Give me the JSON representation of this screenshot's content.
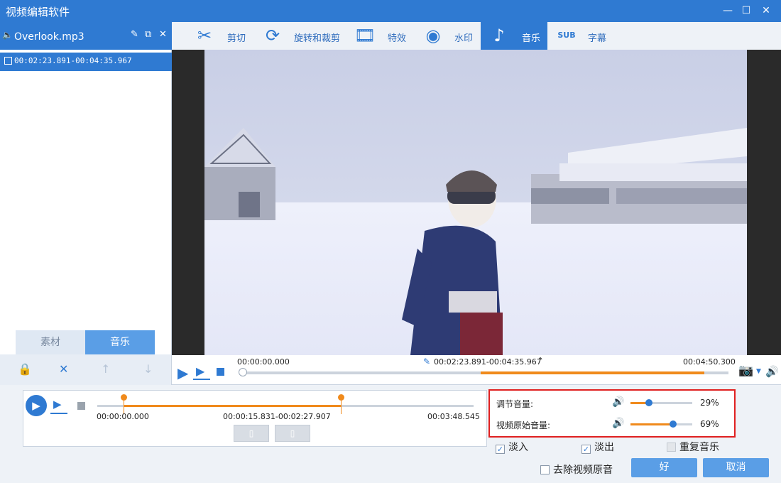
{
  "window": {
    "title": "视频编辑软件",
    "minimize": "—",
    "maximize": "☐",
    "close": "✕"
  },
  "left_panel": {
    "file_name": "Overlook.mp3",
    "segment": "00:02:23.891-00:04:35.967",
    "tabs": [
      {
        "label": "素材"
      },
      {
        "label": "音乐"
      }
    ]
  },
  "toolbar": {
    "items": [
      {
        "label": "剪切",
        "icon": "scissors-icon"
      },
      {
        "label": "旋转和裁剪",
        "icon": "rotate-crop-icon"
      },
      {
        "label": "特效",
        "icon": "effects-icon"
      },
      {
        "label": "水印",
        "icon": "watermark-icon"
      },
      {
        "label": "音乐",
        "icon": "music-note-icon"
      },
      {
        "label": "字幕",
        "icon": "subtitle-icon"
      }
    ]
  },
  "playback": {
    "start_time": "00:00:00.000",
    "segment_range": "00:02:23.891-00:04:35.967",
    "end_time": "00:04:50.300"
  },
  "trim": {
    "start": "00:00:00.000",
    "range": "00:00:15.831-00:02:27.907",
    "end": "00:03:48.545"
  },
  "volume": {
    "adjust_label": "调节音量:",
    "adjust_value": "29%",
    "original_label": "视频原始音量:",
    "original_value": "69%"
  },
  "options": {
    "fade_in": "淡入",
    "fade_out": "淡出",
    "repeat_music": "重复音乐",
    "remove_original_audio": "去除视频原音"
  },
  "buttons": {
    "ok": "好",
    "cancel": "取消"
  }
}
